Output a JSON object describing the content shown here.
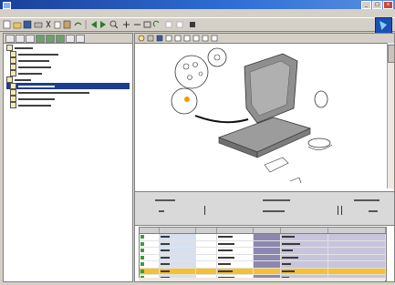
{
  "window": {
    "title": "",
    "buttons": [
      "_",
      "□",
      "x"
    ]
  },
  "menu": {
    "items": []
  },
  "toolbar": {
    "buttons": [
      "new",
      "open",
      "save",
      "print",
      "cut",
      "copy",
      "paste",
      "undo",
      "back",
      "forward",
      "find",
      "zoom-in",
      "zoom-out",
      "fit",
      "refresh",
      "stop",
      "help"
    ]
  },
  "tree": {
    "nodes": [
      {
        "label": "",
        "selected": false,
        "indent": 0
      },
      {
        "label": "",
        "selected": false,
        "indent": 1
      },
      {
        "label": "",
        "selected": false,
        "indent": 1
      },
      {
        "label": "",
        "selected": false,
        "indent": 1
      },
      {
        "label": "",
        "selected": false,
        "indent": 1
      },
      {
        "label": "",
        "selected": false,
        "indent": 0
      },
      {
        "label": "",
        "selected": true,
        "indent": 1
      },
      {
        "label": "",
        "selected": false,
        "indent": 1
      },
      {
        "label": "",
        "selected": false,
        "indent": 1
      },
      {
        "label": "",
        "selected": false,
        "indent": 1
      }
    ]
  },
  "info": {
    "left_label": "",
    "mid_label": "",
    "right_label": "",
    "left_value": "",
    "mid_value": "",
    "right_value": ""
  },
  "grid": {
    "columns": [
      "",
      "",
      "",
      "",
      "",
      "",
      ""
    ],
    "rows": [
      {
        "highlight": false
      },
      {
        "highlight": false
      },
      {
        "highlight": false
      },
      {
        "highlight": false
      },
      {
        "highlight": false
      },
      {
        "highlight": true
      },
      {
        "highlight": false
      },
      {
        "highlight": false
      }
    ]
  },
  "colors": {
    "accent": "#1e3c8f",
    "highlight_row": "#f5c032",
    "shade_col": "#8c87b0"
  }
}
